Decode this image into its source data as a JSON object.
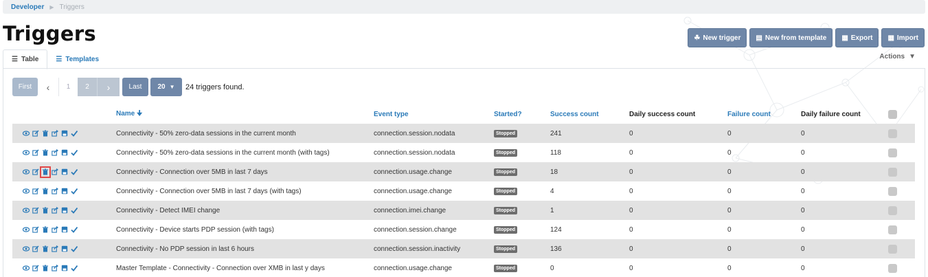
{
  "breadcrumb": {
    "parent": "Developer",
    "current": "Triggers"
  },
  "page_title": "Triggers",
  "top_actions": [
    {
      "label": "New trigger",
      "icon": "sitemap-icon"
    },
    {
      "label": "New from template",
      "icon": "template-icon"
    },
    {
      "label": "Export",
      "icon": "file-export-icon"
    },
    {
      "label": "Import",
      "icon": "file-import-icon"
    }
  ],
  "tabs": [
    {
      "label": "Table",
      "icon": "table-icon",
      "active": true
    },
    {
      "label": "Templates",
      "icon": "list-icon",
      "active": false
    }
  ],
  "actions_menu": {
    "label": "Actions"
  },
  "pager": {
    "first": "First",
    "pages": [
      "1",
      "2"
    ],
    "current_page": "2",
    "last": "Last",
    "page_size": "20",
    "found_text": "24 triggers found."
  },
  "table": {
    "headers": {
      "name": "Name",
      "event_type": "Event type",
      "started": "Started?",
      "success_count": "Success count",
      "daily_success_count": "Daily success count",
      "failure_count": "Failure count",
      "daily_failure_count": "Daily failure count"
    },
    "row_actions": [
      "eye-icon",
      "edit-icon",
      "trash-icon",
      "share-icon",
      "save-icon",
      "check-icon"
    ],
    "rows": [
      {
        "name": "Connectivity - 50% zero-data sessions in the current month",
        "event_type": "connection.session.nodata",
        "started": "Stopped",
        "success_count": "241",
        "daily_success_count": "0",
        "failure_count": "0",
        "daily_failure_count": "0"
      },
      {
        "name": "Connectivity - 50% zero-data sessions in the current month (with tags)",
        "event_type": "connection.session.nodata",
        "started": "Stopped",
        "success_count": "118",
        "daily_success_count": "0",
        "failure_count": "0",
        "daily_failure_count": "0"
      },
      {
        "name": "Connectivity - Connection over 5MB in last 7 days",
        "event_type": "connection.usage.change",
        "started": "Stopped",
        "success_count": "18",
        "daily_success_count": "0",
        "failure_count": "0",
        "daily_failure_count": "0"
      },
      {
        "name": "Connectivity - Connection over 5MB in last 7 days (with tags)",
        "event_type": "connection.usage.change",
        "started": "Stopped",
        "success_count": "4",
        "daily_success_count": "0",
        "failure_count": "0",
        "daily_failure_count": "0"
      },
      {
        "name": "Connectivity - Detect IMEI change",
        "event_type": "connection.imei.change",
        "started": "Stopped",
        "success_count": "1",
        "daily_success_count": "0",
        "failure_count": "0",
        "daily_failure_count": "0"
      },
      {
        "name": "Connectivity - Device starts PDP session (with tags)",
        "event_type": "connection.session.change",
        "started": "Stopped",
        "success_count": "124",
        "daily_success_count": "0",
        "failure_count": "0",
        "daily_failure_count": "0"
      },
      {
        "name": "Connectivity - No PDP session in last 6 hours",
        "event_type": "connection.session.inactivity",
        "started": "Stopped",
        "success_count": "136",
        "daily_success_count": "0",
        "failure_count": "0",
        "daily_failure_count": "0"
      },
      {
        "name": "Master Template - Connectivity - Connection over XMB in last y days",
        "event_type": "connection.usage.change",
        "started": "Stopped",
        "success_count": "0",
        "daily_success_count": "0",
        "failure_count": "0",
        "daily_failure_count": "0"
      }
    ],
    "highlighted": {
      "row": 2,
      "action": "trash-icon"
    }
  },
  "colors": {
    "accent": "#2a7ab8",
    "button": "#6f87a8",
    "row_stripe": "#e2e2e2",
    "badge": "#6d6d6d",
    "highlight": "#e04848"
  }
}
